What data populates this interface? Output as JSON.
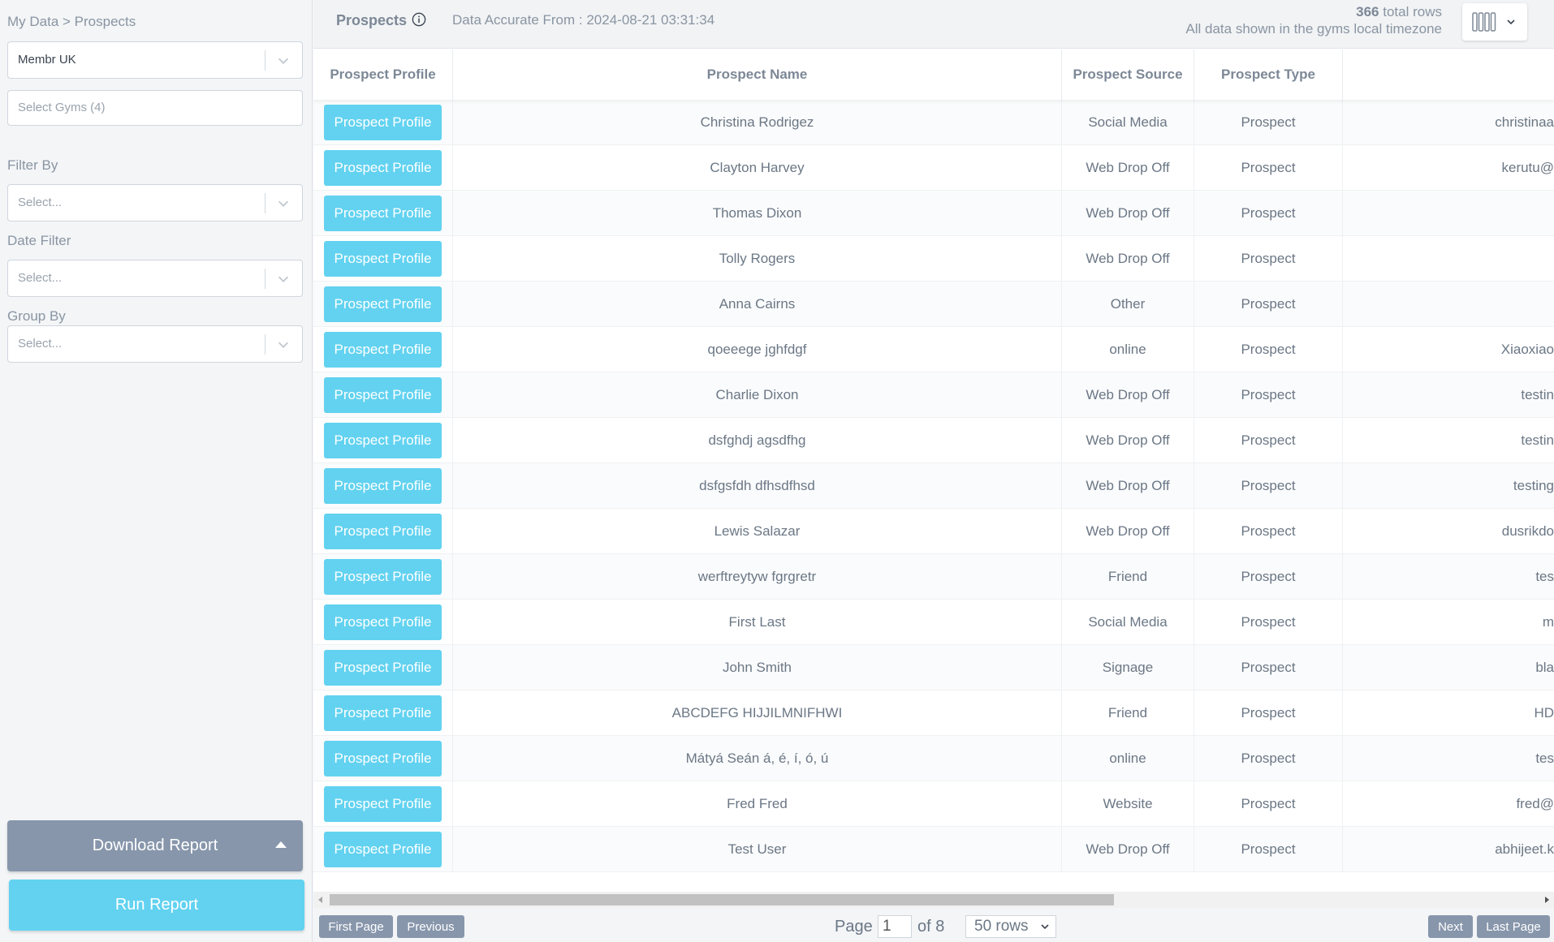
{
  "sidebar": {
    "breadcrumb": "My Data > Prospects",
    "company_select": "Membr UK",
    "gyms_placeholder": "Select Gyms (4)",
    "filter_by_label": "Filter By",
    "filter_by_value": "Select...",
    "date_filter_label": "Date Filter",
    "date_filter_value": "Select...",
    "group_by_label": "Group By",
    "group_by_value": "Select...",
    "download_label": "Download Report",
    "run_label": "Run Report"
  },
  "topbar": {
    "title": "Prospects",
    "accurate_from": "Data Accurate From : 2024-08-21 03:31:34",
    "total_rows_count": "366",
    "total_rows_suffix": " total rows",
    "timezone_note": "All data shown in the gyms local timezone"
  },
  "table": {
    "headers": [
      "Prospect Profile",
      "Prospect Name",
      "Prospect Source",
      "Prospect Type"
    ],
    "button_label": "Prospect Profile",
    "rows": [
      {
        "name": "Christina Rodrigez",
        "source": "Social Media",
        "type": "Prospect",
        "email": "christinaa"
      },
      {
        "name": "Clayton Harvey",
        "source": "Web Drop Off",
        "type": "Prospect",
        "email": "kerutu@"
      },
      {
        "name": "Thomas Dixon",
        "source": "Web Drop Off",
        "type": "Prospect",
        "email": ""
      },
      {
        "name": "Tolly Rogers",
        "source": "Web Drop Off",
        "type": "Prospect",
        "email": ""
      },
      {
        "name": "Anna Cairns",
        "source": "Other",
        "type": "Prospect",
        "email": ""
      },
      {
        "name": "qoeeege jghfdgf",
        "source": "online",
        "type": "Prospect",
        "email": "Xiaoxiao"
      },
      {
        "name": "Charlie Dixon",
        "source": "Web Drop Off",
        "type": "Prospect",
        "email": "testin"
      },
      {
        "name": "dsfghdj agsdfhg",
        "source": "Web Drop Off",
        "type": "Prospect",
        "email": "testin"
      },
      {
        "name": "dsfgsfdh dfhsdfhsd",
        "source": "Web Drop Off",
        "type": "Prospect",
        "email": "testing"
      },
      {
        "name": "Lewis Salazar",
        "source": "Web Drop Off",
        "type": "Prospect",
        "email": "dusrikdo"
      },
      {
        "name": "werftreytyw fgrgretr",
        "source": "Friend",
        "type": "Prospect",
        "email": "tes"
      },
      {
        "name": "First Last",
        "source": "Social Media",
        "type": "Prospect",
        "email": "m"
      },
      {
        "name": "John Smith",
        "source": "Signage",
        "type": "Prospect",
        "email": "bla"
      },
      {
        "name": "ABCDEFG HIJJILMNIFHWI",
        "source": "Friend",
        "type": "Prospect",
        "email": "HD"
      },
      {
        "name": "Mátyá Seán á, é, í, ó, ú",
        "source": "online",
        "type": "Prospect",
        "email": "tes"
      },
      {
        "name": "Fred Fred",
        "source": "Website",
        "type": "Prospect",
        "email": "fred@"
      },
      {
        "name": "Test User",
        "source": "Web Drop Off",
        "type": "Prospect",
        "email": "abhijeet.k"
      }
    ]
  },
  "pager": {
    "first": "First Page",
    "previous": "Previous",
    "page_label": "Page",
    "page_value": "1",
    "of_label": "of 8",
    "rows_per_page": "50 rows",
    "next": "Next",
    "last": "Last Page"
  }
}
